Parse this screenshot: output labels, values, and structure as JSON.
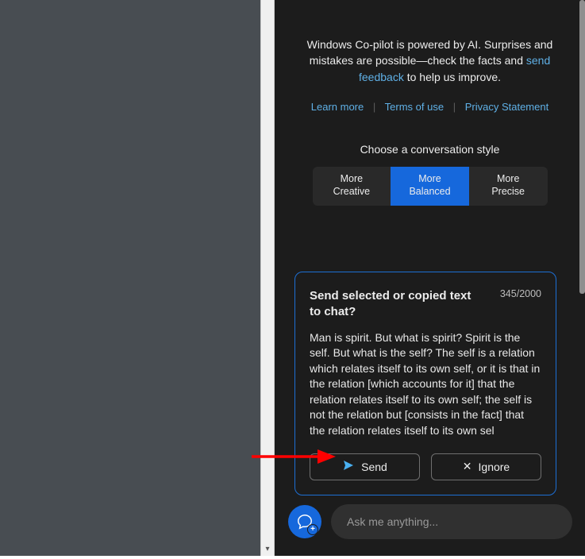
{
  "intro": {
    "text_before_link": "Windows Co-pilot is powered by AI. Surprises and mistakes are possible—check the facts and ",
    "feedback_link": "send feedback",
    "text_after_link": " to help us improve."
  },
  "links": {
    "learn_more": "Learn more",
    "terms": "Terms of use",
    "privacy": "Privacy Statement"
  },
  "style_selector": {
    "heading": "Choose a conversation style",
    "creative_line1": "More",
    "creative_line2": "Creative",
    "balanced_line1": "More",
    "balanced_line2": "Balanced",
    "precise_line1": "More",
    "precise_line2": "Precise"
  },
  "prompt_card": {
    "title": "Send selected or copied text to chat?",
    "counter": "345/2000",
    "body": "Man is spirit. But what is spirit? Spirit is the self. But what is the self? The self is a relation which relates itself to its own self, or it is that in the relation [which accounts for it] that the relation relates itself to its own self; the self is not the relation but [consists in the fact] that the relation relates itself to its own sel",
    "send_label": "Send",
    "ignore_label": "Ignore"
  },
  "input": {
    "placeholder": "Ask me anything..."
  }
}
